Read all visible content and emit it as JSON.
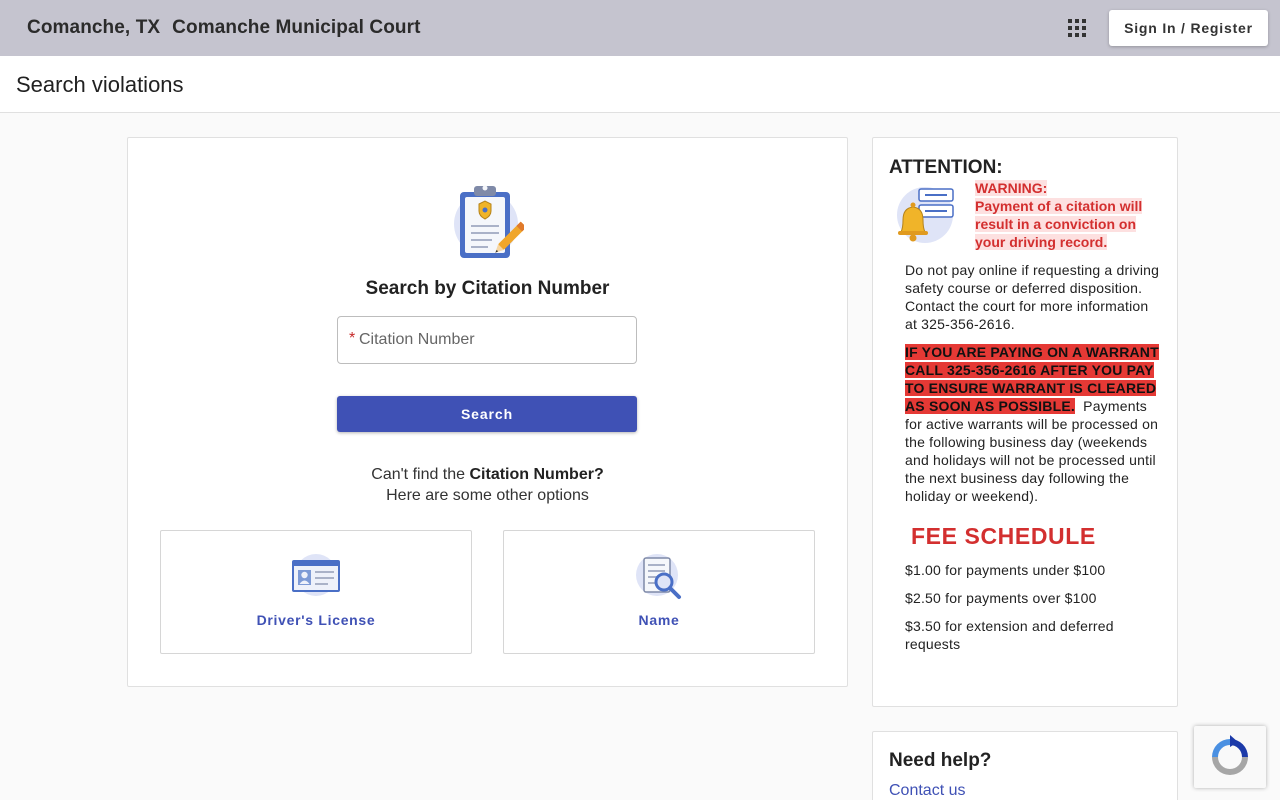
{
  "header": {
    "location": "Comanche, TX",
    "court_name": "Comanche Municipal Court",
    "signin_label": "Sign In / Register"
  },
  "page": {
    "title": "Search violations"
  },
  "search": {
    "title": "Search by Citation Number",
    "citation_placeholder": "Citation Number",
    "required_mark": "*",
    "button_label": "Search",
    "cant_find_prefix": "Can't find the ",
    "cant_find_bold": "Citation Number?",
    "other_options": "Here are some other options",
    "options": [
      {
        "label": "Driver's License",
        "icon": "id-card-icon"
      },
      {
        "label": "Name",
        "icon": "document-search-icon"
      }
    ]
  },
  "attention": {
    "title": "ATTENTION:",
    "warning_label": "WARNING:",
    "warning_text": "Payment of a citation will result in a conviction on your driving record.",
    "paragraph1": "Do not pay online if requesting a driving safety course or deferred disposition. Contact the court for more information at 325-356-2616.",
    "warrant_highlight": "IF YOU ARE PAYING ON A WARRANT CALL 325-356-2616 AFTER YOU PAY TO ENSURE WARRANT IS CLEARED AS SOON AS POSSIBLE.",
    "warrant_text": "Payments for active warrants will be processed on the following business day (weekends and holidays will not be processed until the next business day following the holiday or weekend).",
    "fee_title": "FEE SCHEDULE",
    "fees": [
      "$1.00 for payments under $100",
      "$2.50 for payments over $100",
      "$3.50 for extension and deferred requests"
    ]
  },
  "help": {
    "title": "Need help?",
    "contact_label": "Contact us"
  },
  "colors": {
    "primary": "#3f51b5",
    "header_bg": "#c5c4cf",
    "warning": "#d32f2f"
  }
}
